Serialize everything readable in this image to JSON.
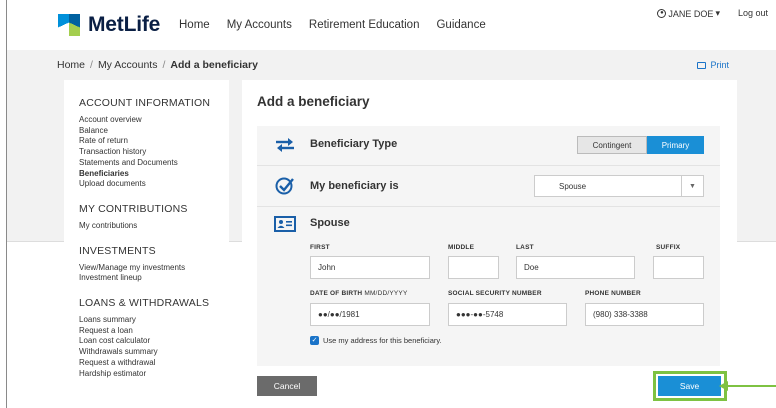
{
  "brand": {
    "name": "MetLife"
  },
  "nav": [
    "Home",
    "My Accounts",
    "Retirement Education",
    "Guidance"
  ],
  "user": {
    "name": "JANE DOE",
    "caret": "▾",
    "logout": "Log out"
  },
  "breadcrumb": {
    "home": "Home",
    "accounts": "My Accounts",
    "current": "Add a beneficiary"
  },
  "print": "Print",
  "sidebar": {
    "account_info": {
      "heading": "ACCOUNT INFORMATION",
      "items": [
        "Account overview",
        "Balance",
        "Rate of return",
        "Transaction history",
        "Statements and Documents",
        "Beneficiaries",
        "Upload documents"
      ],
      "active": "Beneficiaries"
    },
    "contributions": {
      "heading": "MY CONTRIBUTIONS",
      "items": [
        "My contributions"
      ]
    },
    "investments": {
      "heading": "INVESTMENTS",
      "items": [
        "View/Manage my investments",
        "Investment lineup"
      ]
    },
    "loans": {
      "heading": "LOANS & WITHDRAWALS",
      "items": [
        "Loans summary",
        "Request a loan",
        "Loan cost calculator",
        "Withdrawals summary",
        "Request a withdrawal",
        "Hardship estimator"
      ]
    }
  },
  "form": {
    "title": "Add a beneficiary",
    "type_label": "Beneficiary Type",
    "type_options": {
      "contingent": "Contingent",
      "primary": "Primary",
      "selected": "Primary"
    },
    "relation_label": "My beneficiary is",
    "relation_value": "Spouse",
    "section_title": "Spouse",
    "fields": {
      "first": {
        "label": "FIRST",
        "value": "John"
      },
      "middle": {
        "label": "MIDDLE",
        "value": ""
      },
      "last": {
        "label": "LAST",
        "value": "Doe"
      },
      "suffix": {
        "label": "SUFFIX",
        "value": ""
      },
      "dob": {
        "label": "DATE OF BIRTH",
        "sub": "MM/DD/YYYY",
        "value": "●●/●●/1981"
      },
      "ssn": {
        "label": "SOCIAL SECURITY NUMBER",
        "value": "●●●-●●-5748"
      },
      "phone": {
        "label": "PHONE NUMBER",
        "value": "(980) 338-3388"
      }
    },
    "address_checkbox": {
      "label": "Use my address for this beneficiary.",
      "checked": true
    },
    "cancel": "Cancel",
    "save": "Save"
  },
  "colors": {
    "accent": "#1a8fd6",
    "highlight": "#7ec242",
    "brand_blue": "#0090da",
    "brand_green": "#a4ce4e"
  }
}
